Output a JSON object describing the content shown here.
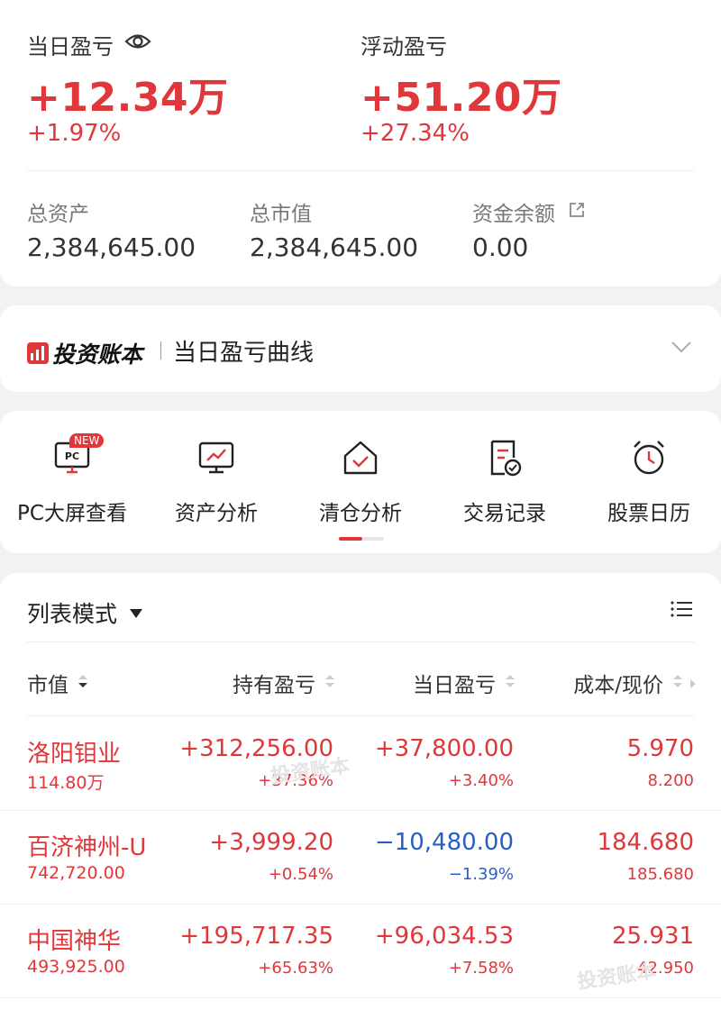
{
  "summary": {
    "today_pl_label": "当日盈亏",
    "today_pl_value": "+12.34万",
    "today_pl_pct": "+1.97%",
    "float_pl_label": "浮动盈亏",
    "float_pl_value": "+51.20万",
    "float_pl_pct": "+27.34%",
    "total_assets_label": "总资产",
    "total_assets_value": "2,384,645.00",
    "market_value_label": "总市值",
    "market_value_value": "2,384,645.00",
    "cash_label": "资金余额",
    "cash_value": "0.00"
  },
  "banner": {
    "brand": "投资账本",
    "title": "当日盈亏曲线"
  },
  "tools": [
    {
      "label": "PC大屏查看",
      "icon": "pc-icon",
      "badge": "NEW"
    },
    {
      "label": "资产分析",
      "icon": "chart-monitor-icon"
    },
    {
      "label": "清仓分析",
      "icon": "house-check-icon"
    },
    {
      "label": "交易记录",
      "icon": "document-check-icon"
    },
    {
      "label": "股票日历",
      "icon": "alarm-clock-icon"
    }
  ],
  "list": {
    "mode_label": "列表模式",
    "headers": [
      "市值",
      "持有盈亏",
      "当日盈亏",
      "成本/现价"
    ],
    "rows": [
      {
        "name": "洛阳钼业",
        "market_value": "114.80万",
        "hold_pl": "+312,256.00",
        "hold_pl_pct": "+37.36%",
        "day_pl": "+37,800.00",
        "day_pl_pct": "+3.40%",
        "cost": "5.970",
        "price": "8.200"
      },
      {
        "name": "百济神州-U",
        "market_value": "742,720.00",
        "hold_pl": "+3,999.20",
        "hold_pl_pct": "+0.54%",
        "day_pl": "−10,480.00",
        "day_pl_pct": "−1.39%",
        "cost": "184.680",
        "price": "185.680"
      },
      {
        "name": "中国神华",
        "market_value": "493,925.00",
        "hold_pl": "+195,717.35",
        "hold_pl_pct": "+65.63%",
        "day_pl": "+96,034.53",
        "day_pl_pct": "+7.58%",
        "cost": "25.931",
        "price": "42.950"
      }
    ],
    "watermark": "投资账本"
  },
  "colors": {
    "up": "#e0373b",
    "down": "#2a5fc1"
  }
}
